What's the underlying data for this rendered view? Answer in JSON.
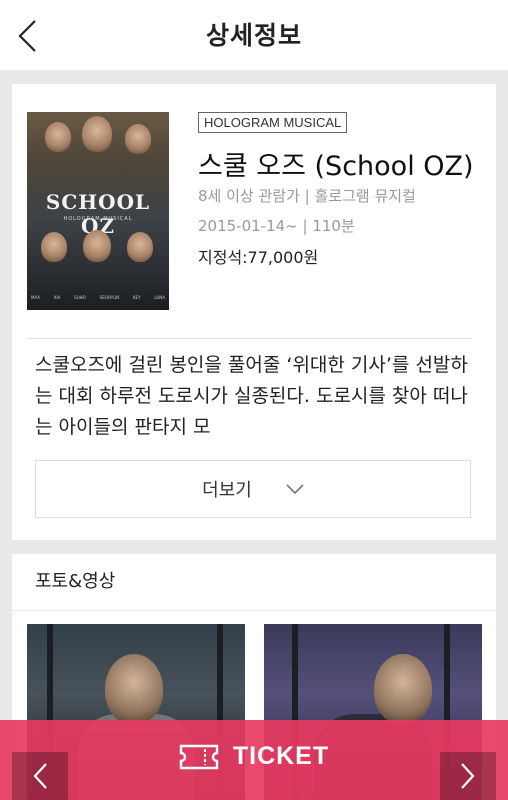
{
  "header": {
    "title": "상세정보",
    "back_icon": "chevron-left-icon"
  },
  "show": {
    "badge": "HOLOGRAM MUSICAL",
    "title": "스쿨 오즈 (School OZ)",
    "rating_genre": "8세 이상 관람가 | 홀로그램 뮤지컬",
    "date_runtime": "2015-01-14~ | 110분",
    "price": "지정석:77,000원",
    "poster": {
      "title": "SCHOOL OZ",
      "subtitle": "HOLOGRAM MUSICAL",
      "names": [
        "MAX",
        "XIA",
        "SUHO",
        "SEOHYUN",
        "KEY",
        "LUNA"
      ]
    },
    "synopsis": "스쿨오즈에 걸린 봉인을 풀어줄 ‘위대한 기사’를 선발하는 대회 하루전 도로시가 실종된다. 도로시를 찾아 떠나는 아이들의 판타지 모",
    "more_label": "더보기",
    "more_icon": "chevron-down-icon"
  },
  "media": {
    "title": "포토&영상"
  },
  "ticket": {
    "label": "TICKET",
    "icon": "ticket-icon",
    "color": "#e83a62"
  },
  "nav": {
    "prev_icon": "chevron-left-icon",
    "next_icon": "chevron-right-icon"
  }
}
